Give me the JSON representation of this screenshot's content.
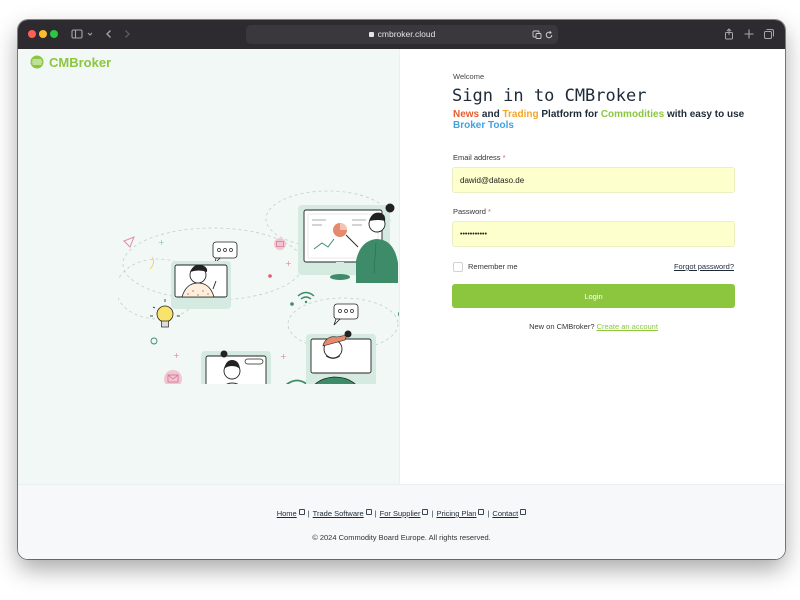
{
  "browser": {
    "url": "cmbroker.cloud",
    "icons": [
      "sidebar-icon",
      "chevron-down-icon",
      "back-icon",
      "forward-icon",
      "lock-icon",
      "translate-icon",
      "reload-icon",
      "share-icon",
      "new-tab-icon",
      "tabs-overview-icon"
    ]
  },
  "brand": {
    "name": "CMBroker",
    "color": "#8cc63f"
  },
  "login": {
    "welcome": "Welcome",
    "title": "Sign in to CMBroker",
    "tagline": {
      "news": "News",
      "and": " and ",
      "trading": "Trading",
      "platform_for": " Platform for ",
      "commodities": "Commodities",
      "with_easy_to_use": " with easy to use ",
      "broker_tools": "Broker Tools"
    },
    "email_label": "Email address",
    "email_value": "dawid@dataso.de",
    "password_label": "Password",
    "password_value": "•••••••••••",
    "required_mark": "*",
    "remember_label": "Remember me",
    "forgot_label": "Forgot password?",
    "login_button": "Login",
    "new_account_text": "New on CMBroker?",
    "create_account_link": "Create an account"
  },
  "footer": {
    "links": [
      "Home",
      "Trade Software",
      "For Supplier",
      "Pricing Plan",
      "Contact"
    ],
    "separator": "|",
    "copyright": "© 2024 Commodity Board Europe. All rights reserved."
  },
  "colors": {
    "accent_green": "#8cc63f",
    "news_orange": "#e85d2f",
    "trading_yellow": "#f5a623",
    "tools_blue": "#3fa3e0",
    "input_bg": "#fdffcc",
    "illustration_green": "#3e8b69"
  }
}
